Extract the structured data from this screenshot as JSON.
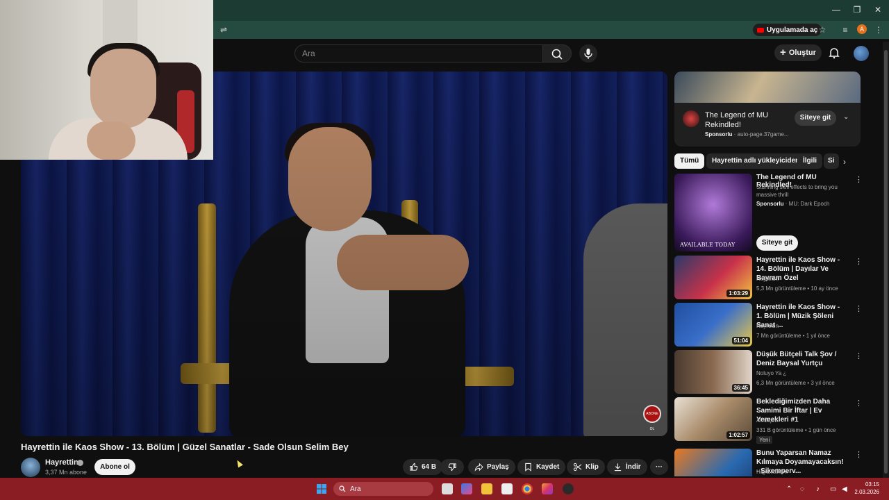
{
  "browser": {
    "open_in_app": "Uygulamada aç",
    "profile_initial": "A"
  },
  "masthead": {
    "search_placeholder": "Ara",
    "create_label": "Oluştur"
  },
  "video": {
    "title": "Hayrettin ile Kaos Show - 13. Bölüm | Güzel Sanatlar - Sade Olsun Selim Bey",
    "channel": "Hayrettin",
    "subscribers": "3,37 Mn abone",
    "subscribe_label": "Abone ol",
    "likes": "64 B",
    "share_label": "Paylaş",
    "save_label": "Kaydet",
    "clip_label": "Klip",
    "download_label": "İndir",
    "overlay_logo": "ABONE OL"
  },
  "sidebar": {
    "ad_card": {
      "title": "The Legend of MU Rekindled!",
      "sponsored": "Sponsorlu",
      "domain": "auto-page.37game...",
      "visit_label": "Siteye git"
    },
    "chips": [
      "Tümü",
      "Hayrettin adlı yükleyiciden",
      "İlgili",
      "Si"
    ],
    "ad_video": {
      "title": "The Legend of MU Rekindled!",
      "description": "Stunning skill effects to bring you massive thrill",
      "sponsored": "Sponsorlu",
      "advertiser": "MU: Dark Epoch",
      "visit_label": "Siteye git",
      "thumb_text": "AVAILABLE TODAY"
    },
    "recommendations": [
      {
        "title": "Hayrettin ile Kaos Show - 14. Bölüm | Dayılar Ve Bayram Özel",
        "channel": "Hayrettin",
        "meta": "5,3 Mn görüntüleme • 10 ay önce",
        "duration": "1:03:29",
        "new": ""
      },
      {
        "title": "Hayrettin ile Kaos Show - 1. Bölüm | Müzik Şöleni Sanat ...",
        "channel": "Hayrettin",
        "meta": "7 Mn görüntüleme • 1 yıl önce",
        "duration": "51:04",
        "new": ""
      },
      {
        "title": "Düşük Bütçeli Talk Şov / Deniz Baysal Yurtçu",
        "channel": "Noluyo Ya ¿",
        "meta": "6,3 Mn görüntüleme • 3 yıl önce",
        "duration": "36:45",
        "new": ""
      },
      {
        "title": "Beklediğimizden Daha Samimi Bir İftar | Ev Yemekleri #1",
        "channel": "Ali Biçim",
        "meta": "331 B görüntüleme • 1 gün önce",
        "duration": "1:02:57",
        "new": "Yeni"
      },
      {
        "title": "Bunu Yaparsan Namaz Kılmaya Doyamayacaksın! - Şikemperv...",
        "channel": "Hayalhanem",
        "meta": "",
        "duration": "",
        "new": ""
      }
    ]
  },
  "taskbar": {
    "search_label": "Ara",
    "time": "03:15",
    "date": "2.03.2026"
  }
}
